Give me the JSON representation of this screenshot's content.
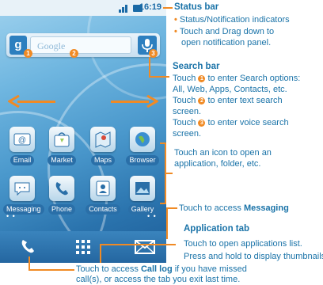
{
  "phone": {
    "status_time": "16:19",
    "search_placeholder": "Google",
    "search_logo": "g",
    "apps_row1": [
      {
        "label": "Email",
        "icon": "email-icon"
      },
      {
        "label": "Market",
        "icon": "market-icon"
      },
      {
        "label": "Maps",
        "icon": "maps-icon"
      },
      {
        "label": "Browser",
        "icon": "browser-icon"
      }
    ],
    "apps_row2": [
      {
        "label": "Messaging",
        "icon": "messaging-icon"
      },
      {
        "label": "Phone",
        "icon": "phone-icon"
      },
      {
        "label": "Contacts",
        "icon": "contacts-icon"
      },
      {
        "label": "Gallery",
        "icon": "gallery-icon"
      }
    ],
    "badges": [
      "1",
      "2",
      "3"
    ]
  },
  "annotations": {
    "status_bar": {
      "title": "Status bar",
      "bullets": [
        "Status/Notification indicators",
        "Touch and Drag down to",
        "open notification panel."
      ]
    },
    "search_bar": {
      "title": "Search bar",
      "line1a": "Touch ",
      "line1b": " to enter Search options:",
      "line2": "All, Web, Apps, Contacts, etc.",
      "line3a": "Touch ",
      "line3b": " to enter text search",
      "line4": "screen.",
      "line5a": "Touch ",
      "line5b": " to enter voice search",
      "line6": "screen."
    },
    "icon_note": {
      "line1": "Touch an icon to open an",
      "line2": "application, folder, etc."
    },
    "messaging_note": {
      "prefix": "Touch to access ",
      "bold": "Messaging"
    },
    "app_tab": {
      "title": "Application tab",
      "line1": "Touch to open applications list.",
      "line2": "Press and hold to display thumbnails."
    },
    "call_log": {
      "prefix": "Touch to access ",
      "bold": "Call log",
      "suffix": " if you have missed",
      "line2": "call(s), or access the tab you exit last time."
    }
  },
  "colors": {
    "accent": "#f08a24",
    "text": "#1a73a8",
    "screen": "#2a73ad"
  }
}
